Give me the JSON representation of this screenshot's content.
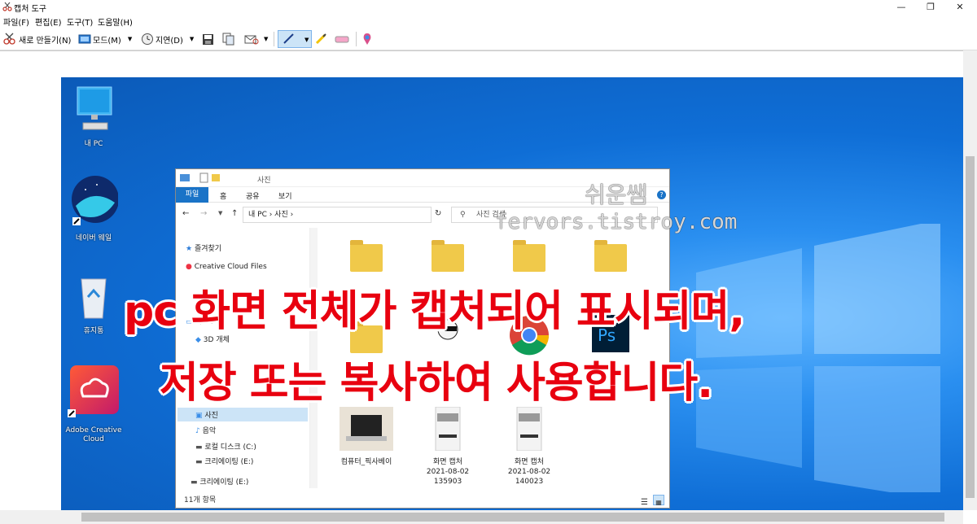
{
  "window": {
    "title": "캡처 도구",
    "minimize": "—",
    "restore": "❐",
    "close": "✕"
  },
  "menu": [
    "파일(F)",
    "편집(E)",
    "도구(T)",
    "도움말(H)"
  ],
  "toolbar": {
    "new": "새로 만들기(N)",
    "mode": "모드(M)",
    "delay": "지연(D)"
  },
  "desktop": {
    "icons": [
      {
        "label": "내 PC"
      },
      {
        "label": "네이버 웨일"
      },
      {
        "label": "휴지통"
      },
      {
        "label": "Adobe Creative Cloud"
      }
    ]
  },
  "explorer": {
    "title": "사진",
    "tabs": [
      "파일",
      "홈",
      "공유",
      "보기"
    ],
    "path": "내 PC  ›  사진  ›",
    "search_placeholder": "사진 검색",
    "nav": [
      {
        "label": "즐겨찾기",
        "icon": "star-icon"
      },
      {
        "label": "Creative Cloud Files",
        "icon": "cloud-icon"
      },
      {
        "label": "내 PC",
        "icon": "pc-icon"
      },
      {
        "label": "3D 개체",
        "icon": "cube-icon"
      },
      {
        "label": "사진",
        "icon": "picture-icon"
      },
      {
        "label": "음악",
        "icon": "music-icon"
      },
      {
        "label": "로컬 디스크 (C:)",
        "icon": "drive-icon"
      },
      {
        "label": "크리에이팅 (E:)",
        "icon": "drive-icon"
      },
      {
        "label": "크리에이팅 (E:)",
        "icon": "drive-icon"
      }
    ],
    "files": [
      {
        "name": "컴퓨터_픽사베이",
        "date": "",
        "time": ""
      },
      {
        "name": "화면 캡처",
        "date": "2021-08-02",
        "time": "135903"
      },
      {
        "name": "화면 캡처",
        "date": "2021-08-02",
        "time": "140023"
      }
    ],
    "status": "11개 항목"
  },
  "overlay": {
    "line1": "pc 화면 전체가 캡처되어 표시되며,",
    "line2": "저장 또는 복사하여 사용합니다."
  },
  "watermark": {
    "line1": "쉬운쌤",
    "line2": "fervors.tistroy.com"
  },
  "colors": {
    "overlay_red": "#e8000f",
    "desktop_blue": "#0f6fd6",
    "ribbon_file": "#1a73c7"
  }
}
